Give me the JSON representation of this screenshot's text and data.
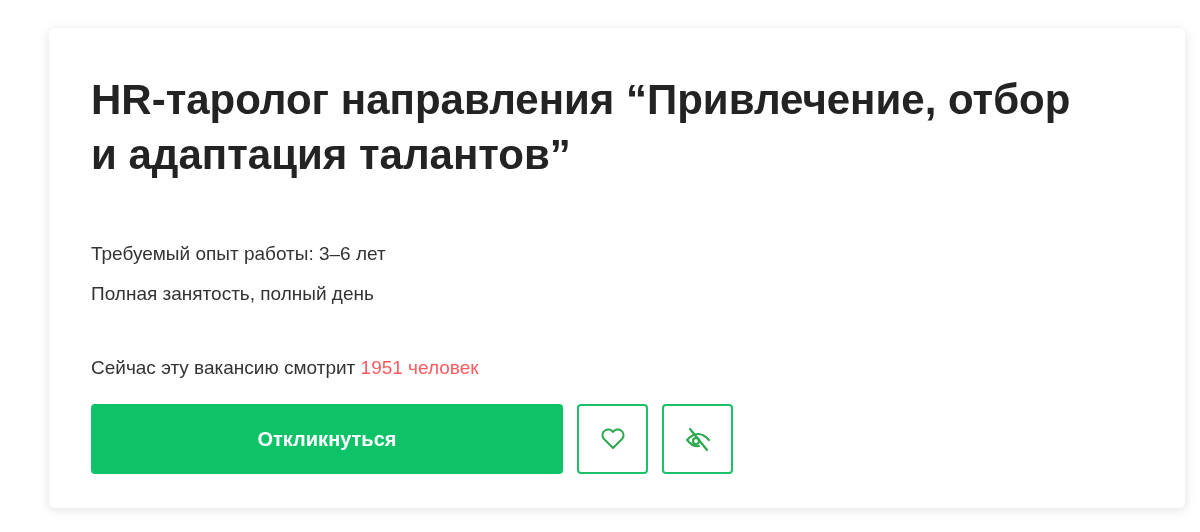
{
  "vacancy": {
    "title": "HR-таролог направления “Привлечение, отбор и адаптация талантов”",
    "experience": "Требуемый опыт работы: 3–6 лет",
    "employment": "Полная занятость, полный день",
    "viewers": {
      "text": "Сейчас эту вакансию смотрит ",
      "count": "1951 человек"
    },
    "apply_button": "Откликнуться"
  }
}
